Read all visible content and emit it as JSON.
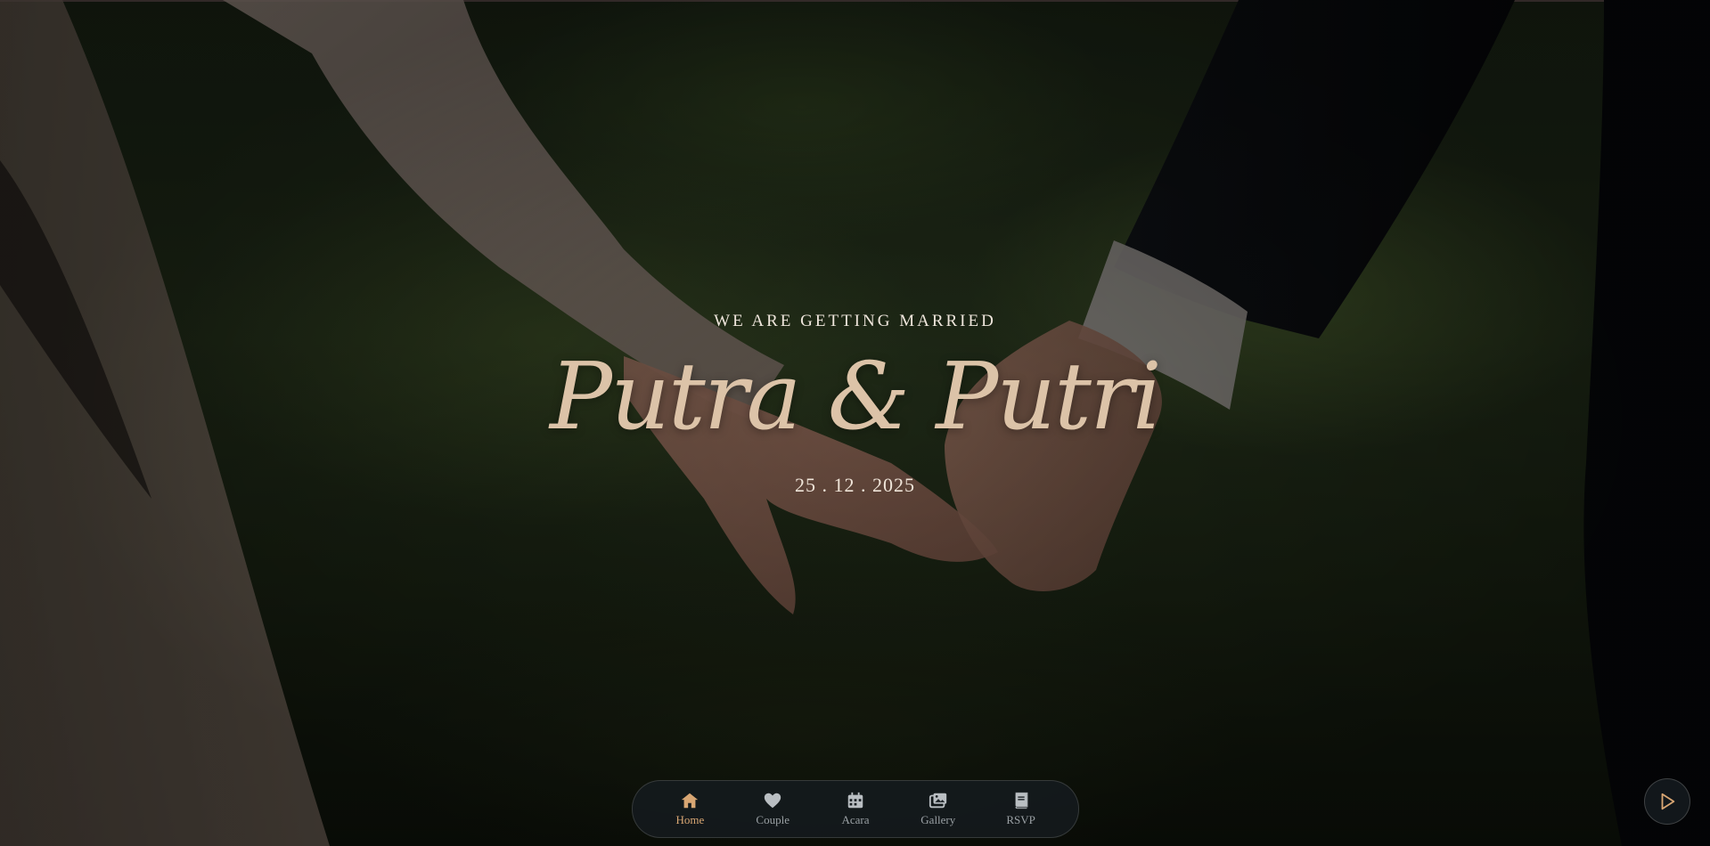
{
  "hero": {
    "tagline": "WE ARE GETTING MARRIED",
    "names": "Putra & Putri",
    "date": "25 . 12 . 2025"
  },
  "nav": {
    "items": [
      {
        "label": "Home",
        "icon": "home-icon",
        "active": true
      },
      {
        "label": "Couple",
        "icon": "heart-icon",
        "active": false
      },
      {
        "label": "Acara",
        "icon": "calendar-icon",
        "active": false
      },
      {
        "label": "Gallery",
        "icon": "images-icon",
        "active": false
      },
      {
        "label": "RSVP",
        "icon": "book-icon",
        "active": false
      }
    ]
  },
  "music": {
    "icon": "play-icon"
  },
  "colors": {
    "accent": "#d8a673",
    "inactive": "#9aa0a4",
    "names": "#dcc3a8"
  }
}
